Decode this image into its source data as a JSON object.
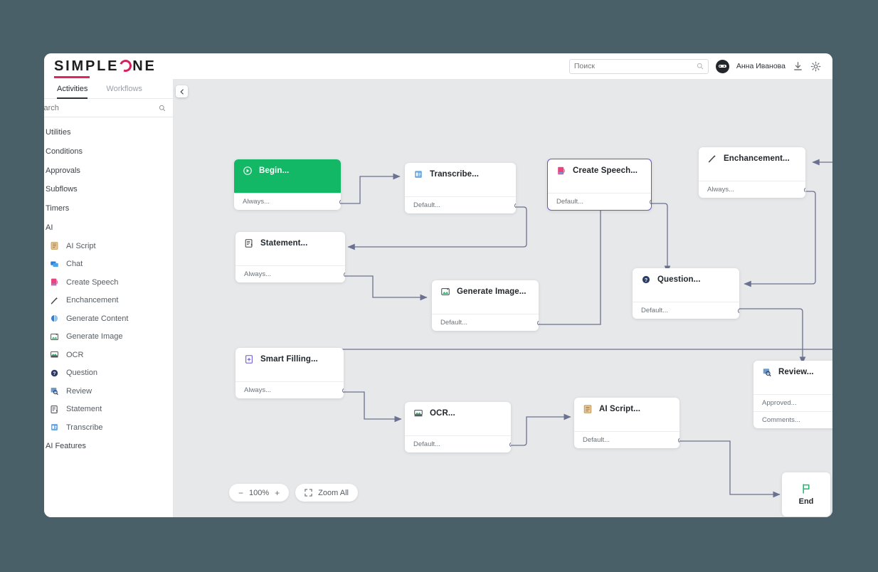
{
  "brand": {
    "name": "SIMPLEONE",
    "accent": "#d6215f"
  },
  "header": {
    "search_placeholder": "Поиск",
    "search_value": "",
    "user_name": "Анна Иванова",
    "download_icon": "download-icon",
    "settings_icon": "gear-icon",
    "avatar_icon": "avatar-icon"
  },
  "sidebar": {
    "tabs": [
      {
        "label": "Activities",
        "active": true
      },
      {
        "label": "Workflows",
        "active": false
      }
    ],
    "search_placeholder": "Search",
    "search_value": "",
    "categories": [
      "Utilities",
      "Conditions",
      "Approvals",
      "Subflows",
      "Timers",
      "AI"
    ],
    "ai_items": [
      {
        "label": "AI Script",
        "icon": "ai-script-icon"
      },
      {
        "label": "Chat",
        "icon": "chat-icon"
      },
      {
        "label": "Create Speech",
        "icon": "create-speech-icon"
      },
      {
        "label": "Enchancement",
        "icon": "enchancement-icon"
      },
      {
        "label": "Generate Content",
        "icon": "generate-content-icon"
      },
      {
        "label": "Generate Image",
        "icon": "generate-image-icon"
      },
      {
        "label": "OCR",
        "icon": "ocr-icon"
      },
      {
        "label": "Question",
        "icon": "question-icon"
      },
      {
        "label": "Review",
        "icon": "review-icon"
      },
      {
        "label": "Statement",
        "icon": "statement-icon"
      },
      {
        "label": "Transcribe",
        "icon": "transcribe-icon"
      }
    ],
    "footer_category": "AI Features",
    "collapse_icon": "chevron-left-icon"
  },
  "canvas": {
    "nodes": [
      {
        "id": "begin",
        "title": "Begin...",
        "icon": "play-icon",
        "ports": [
          "Always..."
        ],
        "style": "green"
      },
      {
        "id": "transcribe",
        "title": "Transcribe...",
        "icon": "transcribe-icon",
        "ports": [
          "Default..."
        ],
        "style": "plain"
      },
      {
        "id": "create-speech",
        "title": "Create Speech...",
        "icon": "create-speech-icon",
        "ports": [
          "Default..."
        ],
        "style": "selected"
      },
      {
        "id": "enchancement",
        "title": "Enchancement...",
        "icon": "enchancement-icon",
        "ports": [
          "Always..."
        ],
        "style": "plain"
      },
      {
        "id": "statement",
        "title": "Statement...",
        "icon": "statement-icon",
        "ports": [
          "Always..."
        ],
        "style": "plain"
      },
      {
        "id": "generate-image",
        "title": "Generate Image...",
        "icon": "generate-image-icon",
        "ports": [
          "Default..."
        ],
        "style": "plain"
      },
      {
        "id": "question",
        "title": "Question...",
        "icon": "question-icon",
        "ports": [
          "Default..."
        ],
        "style": "plain"
      },
      {
        "id": "smart-filling",
        "title": "Smart Filling...",
        "icon": "smart-filling-icon",
        "ports": [
          "Always..."
        ],
        "style": "plain"
      },
      {
        "id": "review",
        "title": "Review...",
        "icon": "review-icon",
        "ports": [
          "Approved...",
          "Comments..."
        ],
        "style": "plain"
      },
      {
        "id": "ocr",
        "title": "OCR...",
        "icon": "ocr-icon",
        "ports": [
          "Default..."
        ],
        "style": "plain"
      },
      {
        "id": "ai-script",
        "title": "AI Script...",
        "icon": "ai-script-icon",
        "ports": [
          "Default..."
        ],
        "style": "plain"
      },
      {
        "id": "end",
        "title": "End",
        "icon": "flag-icon",
        "ports": [],
        "style": "end"
      }
    ],
    "zoom_controls": {
      "minus": "−",
      "level": "100%",
      "plus": "+",
      "zoom_all": "Zoom All",
      "fit_icon": "fit-screen-icon"
    }
  }
}
